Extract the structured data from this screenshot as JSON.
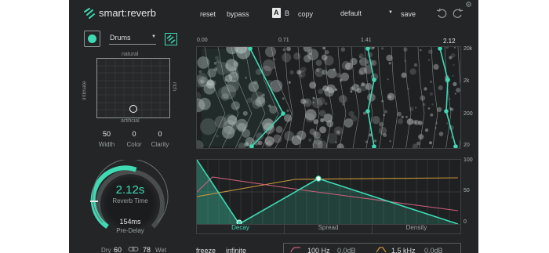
{
  "header": {
    "brand": "smart:reverb",
    "reset_label": "reset",
    "bypass_label": "bypass",
    "ab_a": "A",
    "ab_b": "B",
    "copy_label": "copy",
    "preset_value": "default",
    "save_label": "save"
  },
  "profile": {
    "selected": "Drums"
  },
  "character": {
    "top_label": "natural",
    "bottom_label": "artificial",
    "left_label": "intimate",
    "right_label": "rich",
    "dot_x": 0.5,
    "dot_y": 0.85
  },
  "params": [
    {
      "value": "50",
      "label": "Width"
    },
    {
      "value": "0",
      "label": "Color"
    },
    {
      "value": "0",
      "label": "Clarity"
    }
  ],
  "reverb": {
    "time_value": "2.12s",
    "time_label": "Reverb Time",
    "predelay_value": "154ms",
    "predelay_label": "Pre-Delay",
    "time_fraction": 0.72
  },
  "mix": {
    "dry_label": "Dry",
    "dry_value": "60",
    "wet_value": "78",
    "wet_label": "Wet"
  },
  "timeline": {
    "ticks": [
      "0.00",
      "0.71",
      "1.41",
      "2.12"
    ]
  },
  "freq_axis": [
    "20k",
    "2k",
    "200",
    "20"
  ],
  "envelope": {
    "y_ticks": [
      "100",
      "50",
      "0"
    ],
    "tabs": [
      "Decay",
      "Spread",
      "Density"
    ],
    "active_tab": "Decay"
  },
  "footer": {
    "freeze_label": "freeze",
    "infinite_label": "infinite",
    "lowcut_value": "100 Hz",
    "lowcut_gain": "0.0dB",
    "highshelf_value": "1.5 kHz",
    "highshelf_gain": "0.0dB"
  },
  "colors": {
    "accent": "#3fd9b4",
    "background": "#232526",
    "pink_line": "#c8607a",
    "orange_line": "#c9953a"
  }
}
